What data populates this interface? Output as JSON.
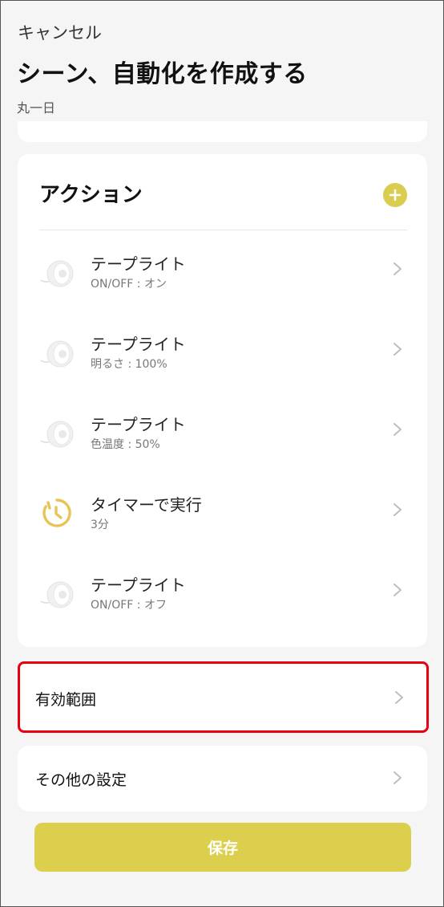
{
  "header": {
    "cancel_label": "キャンセル",
    "title": "シーン、自動化を作成する",
    "subtitle": "丸一日"
  },
  "actions": {
    "title": "アクション",
    "items": [
      {
        "name": "テープライト",
        "detail": "ON/OFF : オン",
        "icon": "tape-light-icon"
      },
      {
        "name": "テープライト",
        "detail": "明るさ : 100%",
        "icon": "tape-light-icon"
      },
      {
        "name": "テープライト",
        "detail": "色温度 : 50%",
        "icon": "tape-light-icon"
      },
      {
        "name": "タイマーで実行",
        "detail": "3分",
        "icon": "timer-icon"
      },
      {
        "name": "テープライト",
        "detail": "ON/OFF : オフ",
        "icon": "tape-light-icon"
      }
    ]
  },
  "validity": {
    "label": "有効範囲"
  },
  "other_settings": {
    "label": "その他の設定"
  },
  "save_label": "保存",
  "colors": {
    "accent": "#dccf4e",
    "highlight_border": "#e60012",
    "background": "#f5f5f5",
    "timer_icon": "#e8c455"
  }
}
